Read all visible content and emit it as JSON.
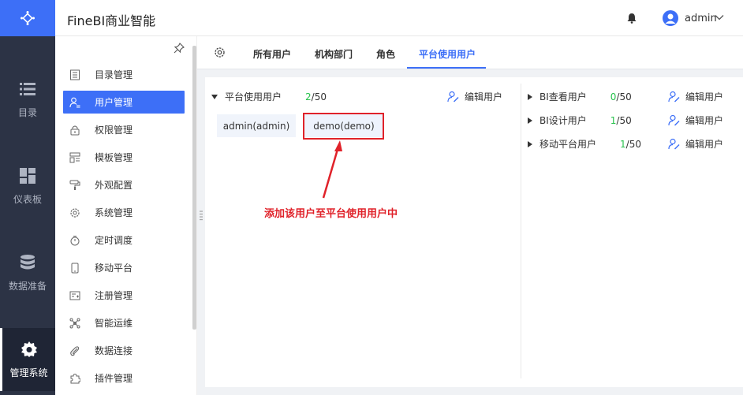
{
  "rail": {
    "items": [
      {
        "label": "目录",
        "icon": "list-icon"
      },
      {
        "label": "仪表板",
        "icon": "dashboard-icon"
      },
      {
        "label": "数据准备",
        "icon": "database-icon"
      },
      {
        "label": "管理系统",
        "icon": "gear-icon",
        "active": true
      }
    ]
  },
  "header": {
    "app_title": "FineBI商业智能",
    "user_name": "admin"
  },
  "submenu": {
    "items": [
      {
        "label": "目录管理",
        "icon": "catalog-icon"
      },
      {
        "label": "用户管理",
        "icon": "user-manage-icon",
        "active": true
      },
      {
        "label": "权限管理",
        "icon": "lock-icon"
      },
      {
        "label": "模板管理",
        "icon": "template-icon"
      },
      {
        "label": "外观配置",
        "icon": "paint-roller-icon"
      },
      {
        "label": "系统管理",
        "icon": "gear-icon"
      },
      {
        "label": "定时调度",
        "icon": "timer-icon"
      },
      {
        "label": "移动平台",
        "icon": "mobile-icon"
      },
      {
        "label": "注册管理",
        "icon": "register-icon"
      },
      {
        "label": "智能运维",
        "icon": "network-icon"
      },
      {
        "label": "数据连接",
        "icon": "paperclip-icon"
      },
      {
        "label": "插件管理",
        "icon": "puzzle-icon"
      }
    ]
  },
  "tabs": [
    {
      "label": "所有用户"
    },
    {
      "label": "机构部门"
    },
    {
      "label": "角色"
    },
    {
      "label": "平台使用用户",
      "active": true
    }
  ],
  "platform_group": {
    "label": "平台使用用户",
    "count": "2",
    "total": "/50",
    "edit_label": "编辑用户",
    "users": [
      "admin(admin)",
      "demo(demo)"
    ]
  },
  "right_groups": [
    {
      "label": "BI查看用户",
      "count": "0",
      "total": "/50",
      "edit_label": "编辑用户"
    },
    {
      "label": "BI设计用户",
      "count": "1",
      "total": "/50",
      "edit_label": "编辑用户"
    },
    {
      "label": "移动平台用户",
      "count": "1",
      "total": "/50",
      "edit_label": "编辑用户"
    }
  ],
  "annotation": {
    "text": "添加该用户至平台使用用户中"
  },
  "colors": {
    "accent": "#3d6ff7",
    "rail_bg": "#2c3345",
    "count_green": "#27c24c",
    "annotation_red": "#e0222a"
  }
}
